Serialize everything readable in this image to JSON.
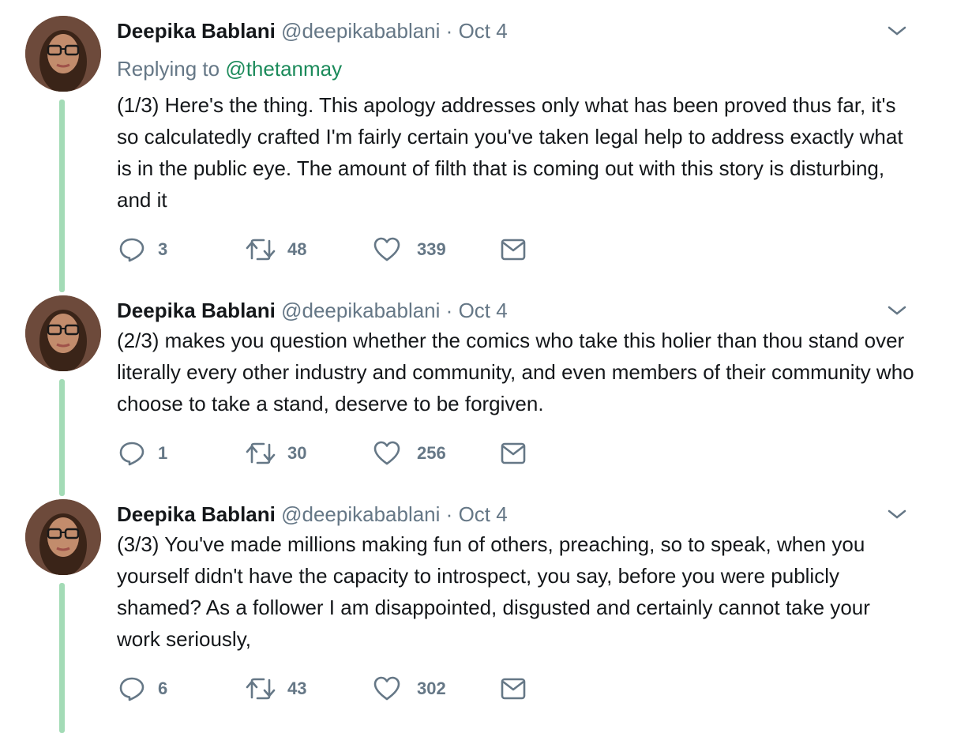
{
  "tweets": [
    {
      "author_name": "Deepika Bablani",
      "author_handle": "@deepikabablani",
      "separator": "·",
      "date": "Oct 4",
      "replying_prefix": "Replying to",
      "replying_handle": "@thetanmay",
      "text": "(1/3) Here's the thing. This apology addresses only what has been proved thus far, it's so calculatedly crafted I'm fairly certain you've taken legal help to address exactly what is in the public eye. The amount of filth that is coming out with this story is disturbing, and it",
      "replies": "3",
      "retweets": "48",
      "likes": "339"
    },
    {
      "author_name": "Deepika Bablani",
      "author_handle": "@deepikabablani",
      "separator": "·",
      "date": "Oct 4",
      "text": "(2/3) makes you question whether the comics who take this holier than thou stand over literally every other industry and community, and even members of their community who choose to take a stand, deserve to be forgiven.",
      "replies": "1",
      "retweets": "30",
      "likes": "256"
    },
    {
      "author_name": "Deepika Bablani",
      "author_handle": "@deepikabablani",
      "separator": "·",
      "date": "Oct 4",
      "text": "(3/3) You've made millions making fun of others, preaching, so to speak, when you yourself didn't have the capacity to introspect, you say, before you were publicly shamed? As a follower I am disappointed, disgusted and certainly cannot take your work seriously,",
      "replies": "6",
      "retweets": "43",
      "likes": "302"
    }
  ],
  "colors": {
    "thread_line": "#a3dbb6",
    "muted": "#657786",
    "mention": "#1b8a5a",
    "text": "#14171a"
  },
  "icons": [
    "reply-icon",
    "retweet-icon",
    "like-icon",
    "message-icon",
    "chevron-down-icon"
  ]
}
